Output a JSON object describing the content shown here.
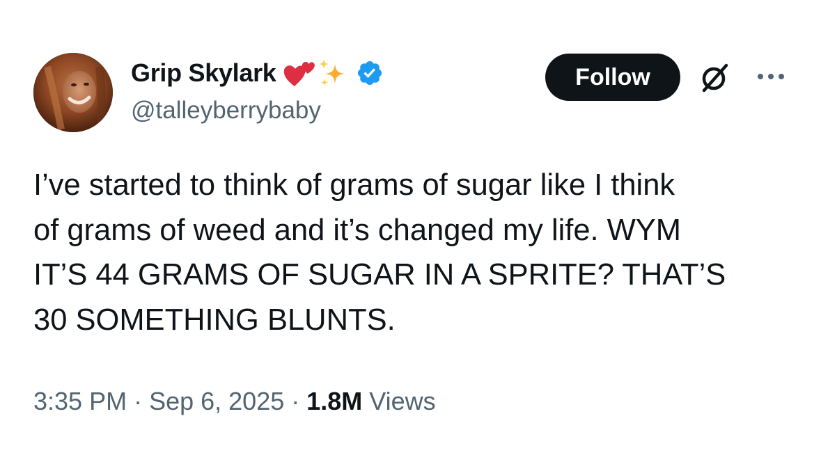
{
  "tweet": {
    "author": {
      "display_name": "Grip Skylark",
      "handle": "@talleyberrybaby",
      "name_emojis": [
        "two-hearts-icon",
        "sparkles-icon"
      ],
      "verified": true,
      "verified_color": "#1d9bf0"
    },
    "follow_label": "Follow",
    "text": "I’ve started to think of grams of sugar like I think\nof grams of weed and it’s changed my life. WYM\nIT’S 44 GRAMS OF SUGAR IN A SPRITE? THAT’S\n30 SOMETHING BLUNTS.",
    "time": "3:35 PM",
    "separator": " · ",
    "date": "Sep 6, 2025",
    "views_count": "1.8M",
    "views_label": " Views"
  },
  "colors": {
    "text_primary": "#0f1419",
    "text_secondary": "#536471",
    "follow_button_bg": "#0f1419",
    "follow_button_text": "#ffffff"
  }
}
